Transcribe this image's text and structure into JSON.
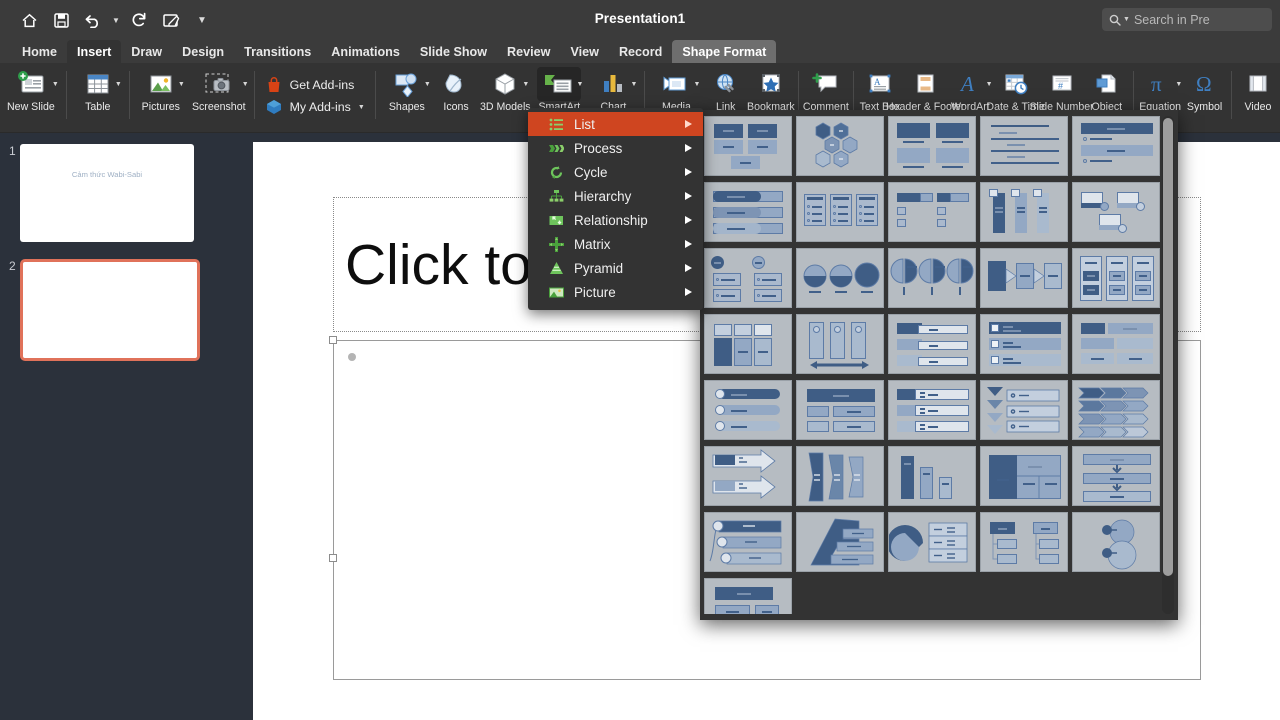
{
  "window": {
    "title": "Presentation1"
  },
  "quick_access": {
    "items": [
      {
        "name": "home-icon",
        "label": "Home"
      },
      {
        "name": "save-icon",
        "label": "Save"
      },
      {
        "name": "undo-icon",
        "label": "Undo"
      },
      {
        "name": "redo-icon",
        "label": "Redo"
      },
      {
        "name": "start-inking-icon",
        "label": "Start Inking"
      },
      {
        "name": "customize-quick-access-icon",
        "label": "Customize"
      }
    ]
  },
  "search": {
    "placeholder": "Search in Pre",
    "icon": "search-icon"
  },
  "tabs": [
    {
      "label": "Home",
      "state": "normal"
    },
    {
      "label": "Insert",
      "state": "active"
    },
    {
      "label": "Draw",
      "state": "normal"
    },
    {
      "label": "Design",
      "state": "normal"
    },
    {
      "label": "Transitions",
      "state": "normal"
    },
    {
      "label": "Animations",
      "state": "normal"
    },
    {
      "label": "Slide Show",
      "state": "normal"
    },
    {
      "label": "Review",
      "state": "normal"
    },
    {
      "label": "View",
      "state": "normal"
    },
    {
      "label": "Record",
      "state": "normal"
    },
    {
      "label": "Shape Format",
      "state": "contextual"
    }
  ],
  "ribbon": {
    "items": [
      {
        "label": "New Slide",
        "icon": "new-slide-icon",
        "caret": true
      },
      {
        "label": "Table",
        "icon": "table-icon",
        "caret": true
      },
      {
        "label": "Pictures",
        "icon": "pictures-icon",
        "caret": true
      },
      {
        "label": "Screenshot",
        "icon": "screenshot-icon",
        "caret": true
      },
      {
        "label": "Shapes",
        "icon": "shapes-icon",
        "caret": true
      },
      {
        "label": "Icons",
        "icon": "icons-icon",
        "caret": false
      },
      {
        "label": "3D Models",
        "icon": "3d-models-icon",
        "caret": true
      },
      {
        "label": "SmartArt",
        "icon": "smartart-icon",
        "caret": true
      },
      {
        "label": "Chart",
        "icon": "chart-icon",
        "caret": true
      },
      {
        "label": "Media",
        "icon": "media-icon",
        "caret": true
      },
      {
        "label": "Link",
        "icon": "link-icon",
        "caret": false
      },
      {
        "label": "Bookmark",
        "icon": "bookmark-icon",
        "caret": false
      },
      {
        "label": "Comment",
        "icon": "comment-icon",
        "caret": false
      },
      {
        "label": "Text Box",
        "icon": "text-box-icon",
        "caret": false
      },
      {
        "label": "Header & Footer",
        "icon": "header-footer-icon",
        "caret": false
      },
      {
        "label": "WordArt",
        "icon": "wordart-icon",
        "caret": true
      },
      {
        "label": "Date & Time",
        "icon": "date-time-icon",
        "caret": false
      },
      {
        "label": "Slide Number",
        "icon": "slide-number-icon",
        "caret": false
      },
      {
        "label": "Object",
        "icon": "object-icon",
        "caret": false
      },
      {
        "label": "Equation",
        "icon": "equation-icon",
        "caret": true
      },
      {
        "label": "Symbol",
        "icon": "symbol-icon",
        "caret": false
      },
      {
        "label": "Video",
        "icon": "video-icon",
        "caret": false
      }
    ],
    "addins": {
      "get_addins": "Get Add-ins",
      "my_addins": "My Add-ins"
    }
  },
  "sidebar": {
    "slides": [
      {
        "number": "1",
        "title": "Cảm thức Wabi-Sabi",
        "selected": false
      },
      {
        "number": "2",
        "title": "",
        "selected": true
      }
    ]
  },
  "slide": {
    "title_placeholder": "Click to a",
    "body_placeholder": ""
  },
  "smartart_menu": {
    "items": [
      {
        "label": "List",
        "icon": "list-icon",
        "selected": true
      },
      {
        "label": "Process",
        "icon": "process-icon",
        "selected": false
      },
      {
        "label": "Cycle",
        "icon": "cycle-icon",
        "selected": false
      },
      {
        "label": "Hierarchy",
        "icon": "hierarchy-icon",
        "selected": false
      },
      {
        "label": "Relationship",
        "icon": "relationship-icon",
        "selected": false
      },
      {
        "label": "Matrix",
        "icon": "matrix-icon",
        "selected": false
      },
      {
        "label": "Pyramid",
        "icon": "pyramid-icon",
        "selected": false
      },
      {
        "label": "Picture",
        "icon": "picture-icon",
        "selected": false
      }
    ]
  },
  "smartart_gallery": {
    "layout_count": 36,
    "columns": 5,
    "layouts": [
      {
        "name": "basic-block-list"
      },
      {
        "name": "alternating-hexagons"
      },
      {
        "name": "picture-caption-list"
      },
      {
        "name": "lined-list"
      },
      {
        "name": "vertical-bullet-list"
      },
      {
        "name": "horizontal-bullet-list"
      },
      {
        "name": "square-accent-list"
      },
      {
        "name": "bending-picture-block-list"
      },
      {
        "name": "vertical-box-list"
      },
      {
        "name": "variable-width-list"
      },
      {
        "name": "vertical-bracket-list"
      },
      {
        "name": "stacked-circles"
      },
      {
        "name": "detailed-process"
      },
      {
        "name": "grouped-list"
      },
      {
        "name": "vertical-block-list"
      },
      {
        "name": "horizontal-picture-list"
      },
      {
        "name": "tab-list"
      },
      {
        "name": "trapezoid-list"
      },
      {
        "name": "table-list"
      },
      {
        "name": "segmented-pyramid"
      },
      {
        "name": "pill-process"
      },
      {
        "name": "hierarchy-block-list"
      },
      {
        "name": "tab-arrow-list"
      },
      {
        "name": "chevron-accent-list"
      },
      {
        "name": "arrow-ribbon"
      },
      {
        "name": "process-arrow-list"
      },
      {
        "name": "vertical-curved-list"
      },
      {
        "name": "vertical-bar-list"
      },
      {
        "name": "grid-matrix-list"
      },
      {
        "name": "stacked-arrow-list"
      },
      {
        "name": "circle-picture-list"
      },
      {
        "name": "pyramid-list"
      },
      {
        "name": "pie-process-list"
      },
      {
        "name": "lined-hierarchy-list"
      },
      {
        "name": "circle-accent-list"
      },
      {
        "name": "block-caption-list"
      }
    ],
    "scrollbar": "vertical-scrollbar"
  }
}
